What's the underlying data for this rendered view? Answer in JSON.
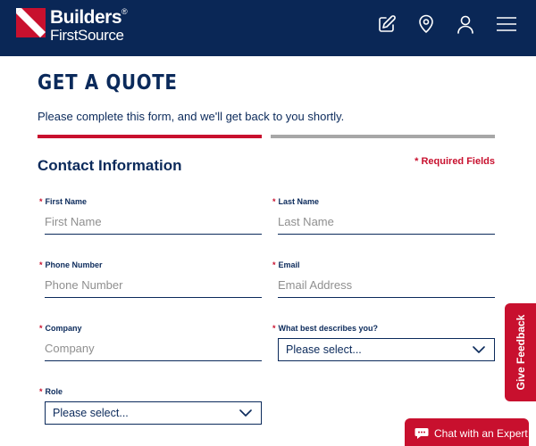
{
  "header": {
    "logo_line1": "Builders",
    "logo_registered": "®",
    "logo_line2": "FirstSource",
    "icons": [
      "edit-quote-icon",
      "location-pin-icon",
      "account-icon",
      "menu-icon"
    ],
    "background_color": "#0a2756"
  },
  "page": {
    "title": "GET A QUOTE",
    "subtitle": "Please complete this form, and we'll get back to you shortly."
  },
  "progress": {
    "current_step": 1,
    "total_steps": 2,
    "active_color": "#c8102e",
    "inactive_color": "#a7a7a7"
  },
  "section": {
    "title": "Contact Information",
    "required_note": "* Required Fields"
  },
  "form": {
    "required_marker": "*",
    "first_name": {
      "label": "First Name",
      "placeholder": "First Name",
      "value": ""
    },
    "last_name": {
      "label": "Last Name",
      "placeholder": "Last Name",
      "value": ""
    },
    "phone": {
      "label": "Phone Number",
      "placeholder": "Phone Number",
      "value": ""
    },
    "email": {
      "label": "Email",
      "placeholder": "Email Address",
      "value": ""
    },
    "company": {
      "label": "Company",
      "placeholder": "Company",
      "value": ""
    },
    "describes": {
      "label": "What best describes you?",
      "selected": "Please select..."
    },
    "role": {
      "label": "Role",
      "selected": "Please select..."
    }
  },
  "widgets": {
    "feedback_label": "Give Feedback",
    "chat_label": "Chat with an Expert",
    "accent_color": "#c8102e"
  }
}
